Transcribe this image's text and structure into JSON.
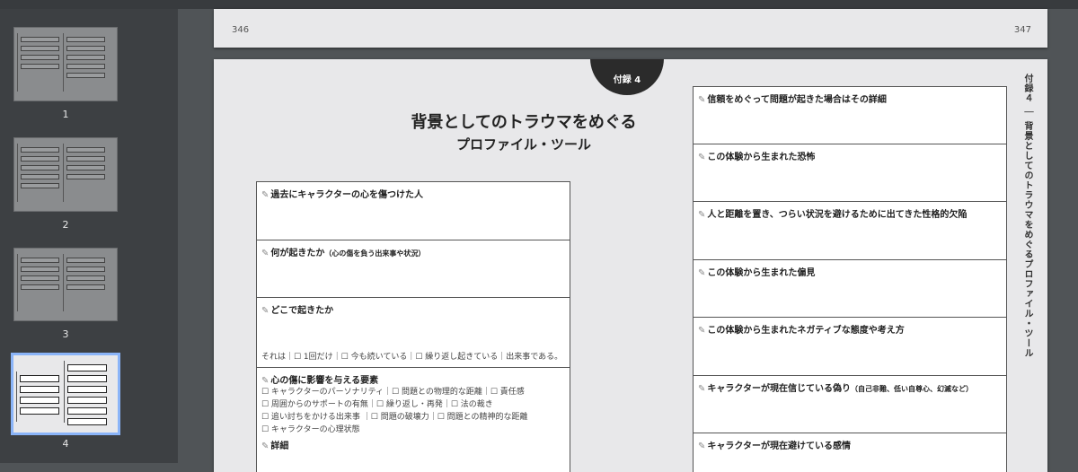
{
  "sidebar": {
    "thumbnails": [
      {
        "label": "1"
      },
      {
        "label": "2"
      },
      {
        "label": "3"
      },
      {
        "label": "4",
        "selected": true
      }
    ]
  },
  "page_prev": {
    "left_number": "346",
    "right_number": "347"
  },
  "page": {
    "tab": "付録 4",
    "title_line1": "背景としてのトラウマをめぐる",
    "title_line2": "プロファイル・ツール",
    "vertical_heading": "付録４ ｜ 背景としてのトラウマをめぐるプロファイル・ツール",
    "pen_icon": "✎",
    "left_boxes": [
      {
        "heading": "過去にキャラクターの心を傷つけた人"
      },
      {
        "heading": "何が起きたか",
        "note": "（心の傷を負う出来事や状況）"
      },
      {
        "heading": "どこで起きたか",
        "footer": "それは｜☐ 1回だけ｜☐ 今も続いている｜☐ 繰り返し起きている｜出来事である。"
      },
      {
        "heading": "心の傷に影響を与える要素",
        "options": [
          "☐ キャラクターのパーソナリティ｜☐ 問題との物理的な距離｜☐ 責任感",
          "☐ 周囲からのサポートの有無｜☐ 繰り返し・再発｜☐ 法の裁き",
          "☐ 追い討ちをかける出来事 ｜☐ 問題の破壊力｜☐ 問題との精神的な距離",
          "☐ キャラクターの心理状態"
        ],
        "sub_heading": "詳細"
      }
    ],
    "right_boxes": [
      {
        "heading": "信頼をめぐって問題が起きた場合はその詳細"
      },
      {
        "heading": "この体験から生まれた恐怖"
      },
      {
        "heading": "人と距離を置き、つらい状況を避けるために出てきた性格的欠陥"
      },
      {
        "heading": "この体験から生まれた偏見"
      },
      {
        "heading": "この体験から生まれたネガティブな態度や考え方"
      },
      {
        "heading": "キャラクターが現在信じている偽り",
        "note": "（自己非難、低い自尊心、幻滅など）"
      },
      {
        "heading": "キャラクターが現在避けている感情"
      }
    ]
  }
}
